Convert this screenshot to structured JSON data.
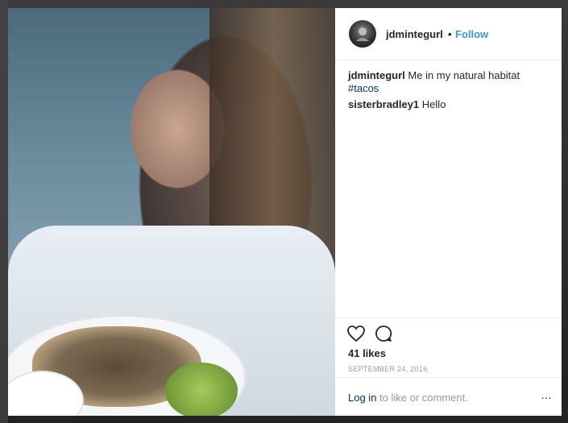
{
  "post": {
    "username": "jdmintegurl",
    "separator": "•",
    "follow_label": "Follow",
    "caption_text": "Me in my natural habitat",
    "caption_tag": "#tacos",
    "comments": [
      {
        "user": "sisterbradley1",
        "text": "Hello"
      }
    ],
    "likes_text": "41 likes",
    "date": "SEPTEMBER 24, 2016"
  },
  "footer": {
    "login_link": "Log in",
    "login_rest": "to like or comment.",
    "more_icon": "…"
  },
  "icons": {
    "like": "heart-icon",
    "comment": "comment-icon",
    "more": "more-options-icon"
  },
  "colors": {
    "accent": "#3897f0",
    "text": "#262626",
    "muted": "#999999",
    "hashtag": "#003569"
  }
}
